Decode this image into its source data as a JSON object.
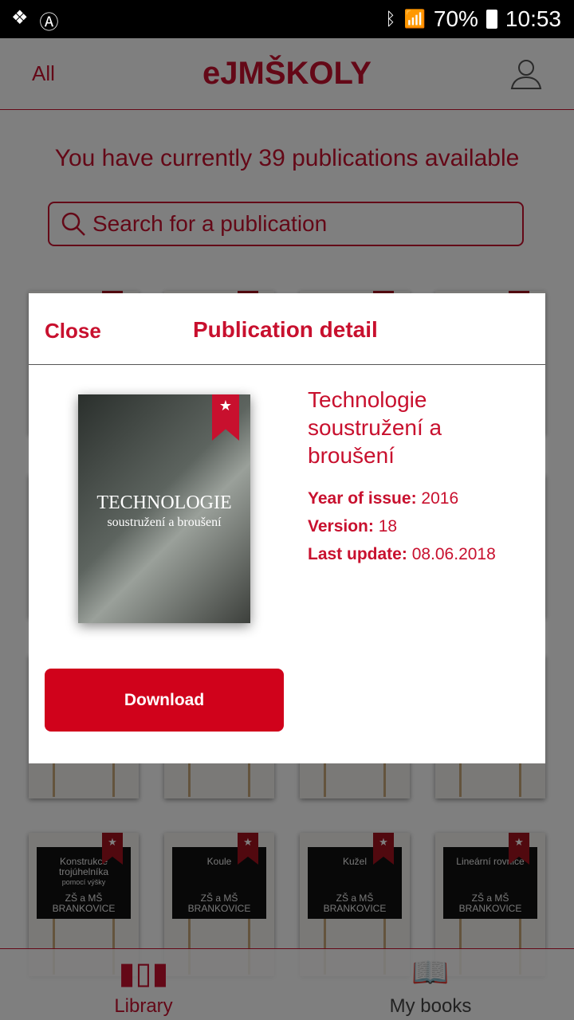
{
  "status_bar": {
    "battery": "70%",
    "time": "10:53"
  },
  "header": {
    "filter_label": "All",
    "logo": "eJMŠKOLY"
  },
  "count_text": "You have currently 39 publications available",
  "search": {
    "placeholder": "Search for a publication"
  },
  "grid_cards": [
    {
      "title": "Konstrukce trojúhelníka",
      "subtitle": "pomocí výšky",
      "school": "ZŠ a MŠ BRANKOVICE"
    },
    {
      "title": "Koule",
      "subtitle": "",
      "school": "ZŠ a MŠ BRANKOVICE"
    },
    {
      "title": "Kužel",
      "subtitle": "",
      "school": "ZŠ a MŠ BRANKOVICE"
    },
    {
      "title": "Lineární rovnice",
      "subtitle": "",
      "school": "ZŠ a MŠ BRANKOVICE"
    }
  ],
  "tabs": [
    {
      "label": "Library",
      "active": true
    },
    {
      "label": "My books",
      "active": false
    }
  ],
  "modal": {
    "close_label": "Close",
    "title": "Publication detail",
    "cover": {
      "line1": "TECHNOLOGIE",
      "line2": "soustružení a broušení"
    },
    "publication_title": "Technologie soustružení a broušení",
    "year_label": "Year of issue:",
    "year": "2016",
    "version_label": "Version:",
    "version": "18",
    "update_label": "Last update:",
    "update": "08.06.2018",
    "download_label": "Download"
  },
  "colors": {
    "accent": "#c8102e",
    "button": "#d0021b"
  }
}
